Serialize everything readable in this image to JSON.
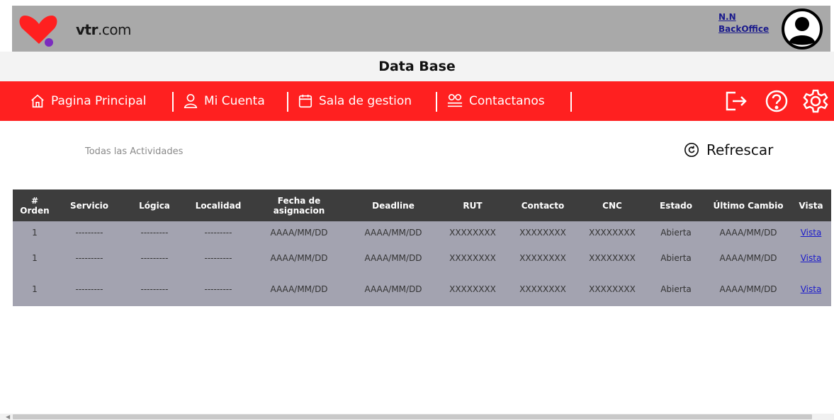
{
  "header": {
    "brand_bold": "vtr",
    "brand_suffix": ".com",
    "user_name": "N.N",
    "user_role": "BackOffice"
  },
  "page_title": "Data Base",
  "nav": {
    "items": [
      {
        "label": "Pagina Principal",
        "icon": "home-icon"
      },
      {
        "label": "Mi Cuenta",
        "icon": "user-icon"
      },
      {
        "label": "Sala de gestion",
        "icon": "calendar-icon"
      },
      {
        "label": "Contactanos",
        "icon": "users-icon"
      }
    ],
    "right_icons": [
      "logout-icon",
      "help-icon",
      "settings-icon"
    ]
  },
  "section": {
    "title": "Todas las Actividades",
    "refresh_label": "Refrescar"
  },
  "table": {
    "headers": [
      "# Orden",
      "Servicio",
      "Lógica",
      "Localidad",
      "Fecha de asignacion",
      "Deadline",
      "RUT",
      "Contacto",
      "CNC",
      "Estado",
      "Último Cambio",
      "Vista"
    ],
    "rows": [
      [
        "1",
        "---------",
        "---------",
        "---------",
        "AAAA/MM/DD",
        "AAAA/MM/DD",
        "XXXXXXXX",
        "XXXXXXXX",
        "XXXXXXXX",
        "Abierta",
        "AAAA/MM/DD",
        "Vista"
      ],
      [
        "1",
        "---------",
        "---------",
        "---------",
        "AAAA/MM/DD",
        "AAAA/MM/DD",
        "XXXXXXXX",
        "XXXXXXXX",
        "XXXXXXXX",
        "Abierta",
        "AAAA/MM/DD",
        "Vista"
      ],
      [
        "1",
        "---------",
        "---------",
        "---------",
        "AAAA/MM/DD",
        "AAAA/MM/DD",
        "XXXXXXXX",
        "XXXXXXXX",
        "XXXXXXXX",
        "Abierta",
        "AAAA/MM/DD",
        "Vista"
      ]
    ]
  },
  "colors": {
    "accent": "#ff2020",
    "header_bg": "#a9a9a9",
    "table_head": "#3d3d3d",
    "table_body": "#a3a3b0",
    "logo_dot": "#7b2cbf"
  }
}
